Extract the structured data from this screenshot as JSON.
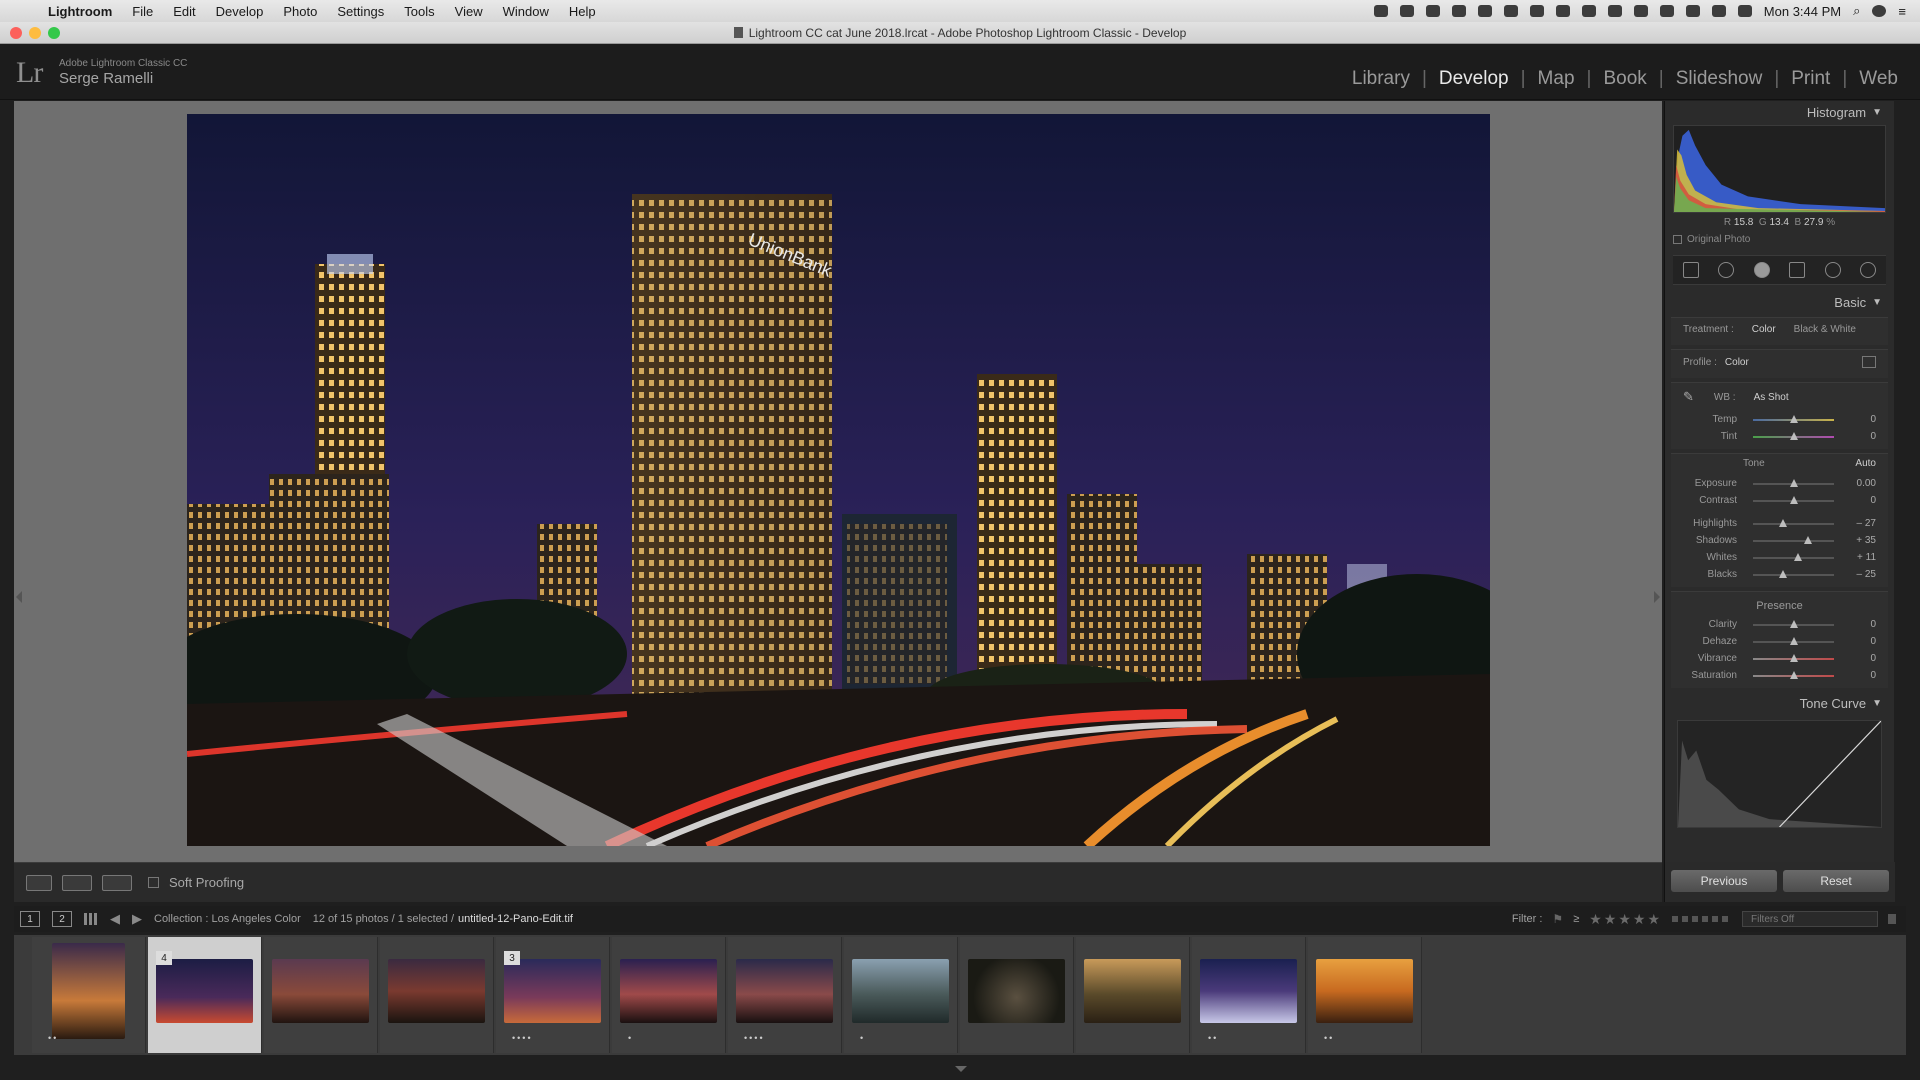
{
  "menubar": {
    "app": "Lightroom",
    "items": [
      "File",
      "Edit",
      "Develop",
      "Photo",
      "Settings",
      "Tools",
      "View",
      "Window",
      "Help"
    ],
    "clock": "Mon 3:44 PM"
  },
  "window": {
    "title": "Lightroom CC cat June 2018.lrcat - Adobe Photoshop Lightroom Classic - Develop"
  },
  "identity": {
    "logo": "Lr",
    "product": "Adobe Lightroom Classic CC",
    "user": "Serge Ramelli"
  },
  "modules": [
    {
      "label": "Library"
    },
    {
      "label": "Develop"
    },
    {
      "label": "Map"
    },
    {
      "label": "Book"
    },
    {
      "label": "Slideshow"
    },
    {
      "label": "Print"
    },
    {
      "label": "Web"
    }
  ],
  "active_module": "Develop",
  "toolbar": {
    "soft_proofing": "Soft Proofing"
  },
  "panel": {
    "histogram": {
      "title": "Histogram",
      "readout": {
        "r_label": "R",
        "r": "15.8",
        "g_label": "G",
        "g": "13.4",
        "b_label": "B",
        "b": "27.9",
        "unit": "%"
      },
      "original_photo": "Original Photo"
    },
    "basic": {
      "title": "Basic",
      "treatment_label": "Treatment :",
      "treatment_color": "Color",
      "treatment_bw": "Black & White",
      "profile_label": "Profile :",
      "profile_value": "Color",
      "wb_label": "WB :",
      "wb_value": "As Shot",
      "temp": {
        "label": "Temp",
        "value": "0",
        "pos": 0.5
      },
      "tint": {
        "label": "Tint",
        "value": "0",
        "pos": 0.5
      },
      "tone_label": "Tone",
      "auto_label": "Auto",
      "exposure": {
        "label": "Exposure",
        "value": "0.00",
        "pos": 0.5
      },
      "contrast": {
        "label": "Contrast",
        "value": "0",
        "pos": 0.5
      },
      "highlights": {
        "label": "Highlights",
        "value": "– 27",
        "pos": 0.365
      },
      "shadows": {
        "label": "Shadows",
        "value": "+ 35",
        "pos": 0.675
      },
      "whites": {
        "label": "Whites",
        "value": "+ 11",
        "pos": 0.555
      },
      "blacks": {
        "label": "Blacks",
        "value": "– 25",
        "pos": 0.375
      },
      "presence_label": "Presence",
      "clarity": {
        "label": "Clarity",
        "value": "0",
        "pos": 0.5
      },
      "dehaze": {
        "label": "Dehaze",
        "value": "0",
        "pos": 0.5
      },
      "vibrance": {
        "label": "Vibrance",
        "value": "0",
        "pos": 0.5
      },
      "saturation": {
        "label": "Saturation",
        "value": "0",
        "pos": 0.5
      }
    },
    "tone_curve": {
      "title": "Tone Curve"
    },
    "previous": "Previous",
    "reset": "Reset"
  },
  "filmstrip_bar": {
    "view1": "1",
    "view2": "2",
    "collection": "Collection : Los Angeles Color",
    "count": "12 of 15 photos / 1 selected /",
    "filename": "untitled-12-Pano-Edit.tif",
    "filter_label": "Filter :",
    "rating_op": "≥",
    "stars": "★★★★★",
    "filters_off": "Filters Off"
  },
  "filmstrip": [
    {
      "badge": "",
      "dots": "••"
    },
    {
      "badge": "4",
      "dots": ""
    },
    {
      "badge": "",
      "dots": ""
    },
    {
      "badge": "",
      "dots": ""
    },
    {
      "badge": "3",
      "dots": "••••"
    },
    {
      "badge": "",
      "dots": "•"
    },
    {
      "badge": "",
      "dots": "••••"
    },
    {
      "badge": "",
      "dots": "•"
    },
    {
      "badge": "",
      "dots": ""
    },
    {
      "badge": "",
      "dots": ""
    },
    {
      "badge": "",
      "dots": "••"
    },
    {
      "badge": "",
      "dots": "••"
    }
  ]
}
